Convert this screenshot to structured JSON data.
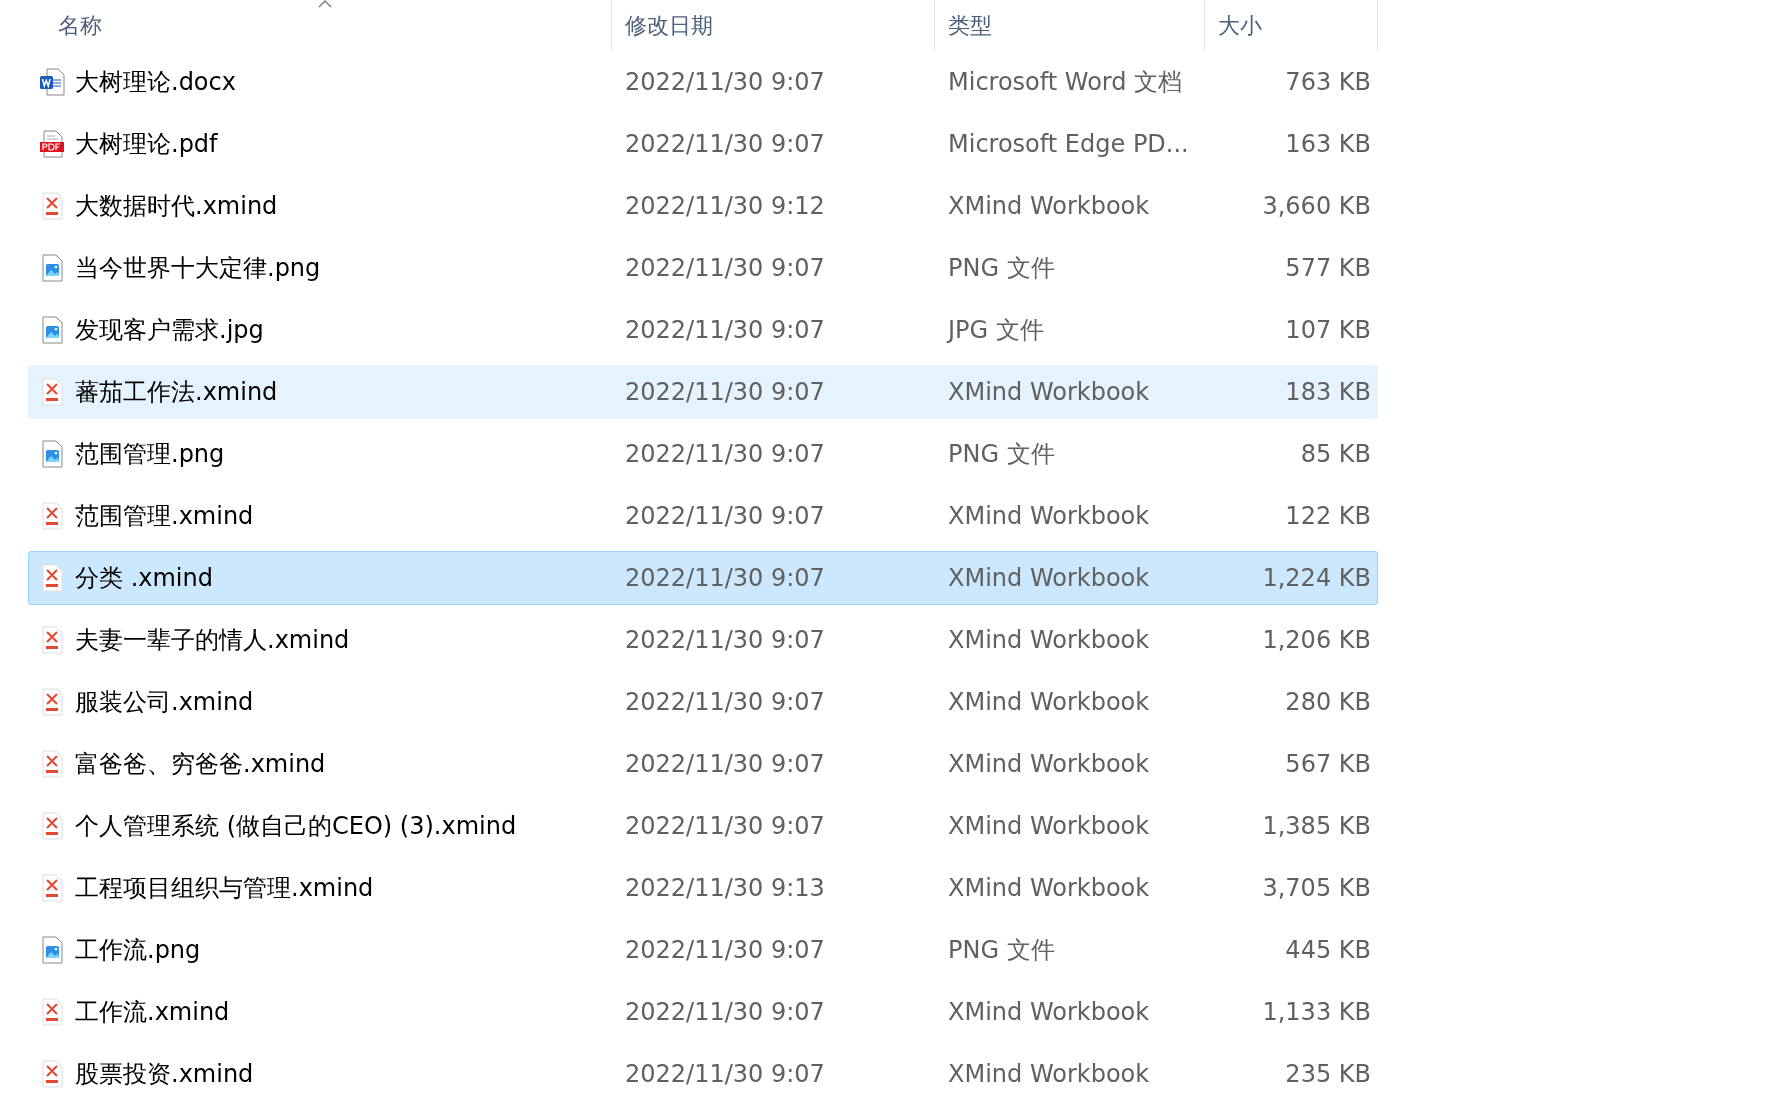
{
  "columns": [
    {
      "label": "名称",
      "sorted": true
    },
    {
      "label": "修改日期",
      "sorted": false
    },
    {
      "label": "类型",
      "sorted": false
    },
    {
      "label": "大小",
      "sorted": false
    }
  ],
  "files": [
    {
      "kind": "word",
      "name": "大树理论.docx",
      "date": "2022/11/30 9:07",
      "type": "Microsoft Word 文档",
      "size": "763 KB",
      "hovered": false,
      "selected": false
    },
    {
      "kind": "pdf",
      "name": "大树理论.pdf",
      "date": "2022/11/30 9:07",
      "type": "Microsoft Edge PD...",
      "size": "163 KB",
      "hovered": false,
      "selected": false
    },
    {
      "kind": "xmind",
      "name": "大数据时代.xmind",
      "date": "2022/11/30 9:12",
      "type": "XMind Workbook",
      "size": "3,660 KB",
      "hovered": false,
      "selected": false
    },
    {
      "kind": "image",
      "name": "当今世界十大定律.png",
      "date": "2022/11/30 9:07",
      "type": "PNG 文件",
      "size": "577 KB",
      "hovered": false,
      "selected": false
    },
    {
      "kind": "image",
      "name": "发现客户需求.jpg",
      "date": "2022/11/30 9:07",
      "type": "JPG 文件",
      "size": "107 KB",
      "hovered": false,
      "selected": false
    },
    {
      "kind": "xmind",
      "name": "蕃茄工作法.xmind",
      "date": "2022/11/30 9:07",
      "type": "XMind Workbook",
      "size": "183 KB",
      "hovered": true,
      "selected": false
    },
    {
      "kind": "image",
      "name": "范围管理.png",
      "date": "2022/11/30 9:07",
      "type": "PNG 文件",
      "size": "85 KB",
      "hovered": false,
      "selected": false
    },
    {
      "kind": "xmind",
      "name": "范围管理.xmind",
      "date": "2022/11/30 9:07",
      "type": "XMind Workbook",
      "size": "122 KB",
      "hovered": false,
      "selected": false
    },
    {
      "kind": "xmind",
      "name": "分类 .xmind",
      "date": "2022/11/30 9:07",
      "type": "XMind Workbook",
      "size": "1,224 KB",
      "hovered": false,
      "selected": true
    },
    {
      "kind": "xmind",
      "name": "夫妻一辈子的情人.xmind",
      "date": "2022/11/30 9:07",
      "type": "XMind Workbook",
      "size": "1,206 KB",
      "hovered": false,
      "selected": false
    },
    {
      "kind": "xmind",
      "name": "服装公司.xmind",
      "date": "2022/11/30 9:07",
      "type": "XMind Workbook",
      "size": "280 KB",
      "hovered": false,
      "selected": false
    },
    {
      "kind": "xmind",
      "name": "富爸爸、穷爸爸.xmind",
      "date": "2022/11/30 9:07",
      "type": "XMind Workbook",
      "size": "567 KB",
      "hovered": false,
      "selected": false
    },
    {
      "kind": "xmind",
      "name": "个人管理系统 (做自己的CEO) (3).xmind",
      "date": "2022/11/30 9:07",
      "type": "XMind Workbook",
      "size": "1,385 KB",
      "hovered": false,
      "selected": false
    },
    {
      "kind": "xmind",
      "name": "工程项目组织与管理.xmind",
      "date": "2022/11/30 9:13",
      "type": "XMind Workbook",
      "size": "3,705 KB",
      "hovered": false,
      "selected": false
    },
    {
      "kind": "image",
      "name": "工作流.png",
      "date": "2022/11/30 9:07",
      "type": "PNG 文件",
      "size": "445 KB",
      "hovered": false,
      "selected": false
    },
    {
      "kind": "xmind",
      "name": "工作流.xmind",
      "date": "2022/11/30 9:07",
      "type": "XMind Workbook",
      "size": "1,133 KB",
      "hovered": false,
      "selected": false
    },
    {
      "kind": "xmind",
      "name": "股票投资.xmind",
      "date": "2022/11/30 9:07",
      "type": "XMind Workbook",
      "size": "235 KB",
      "hovered": false,
      "selected": false
    }
  ]
}
